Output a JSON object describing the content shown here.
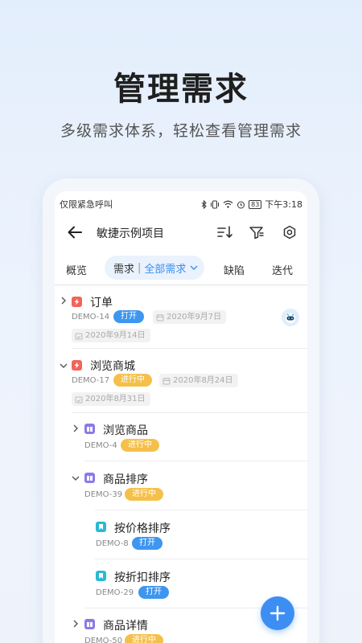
{
  "promo": {
    "title": "管理需求",
    "subtitle": "多级需求体系，轻松查看管理需求"
  },
  "status_bar": {
    "left_text": "仅限紧急呼叫",
    "battery": "83",
    "time": "下午3:18"
  },
  "header": {
    "title": "敏捷示例项目"
  },
  "tabs": {
    "overview": "概览",
    "requirements": "需求",
    "requirements_separator": "|",
    "requirements_filter": "全部需求",
    "defects": "缺陷",
    "iterations": "迭代"
  },
  "items": [
    {
      "title": "订单",
      "id": "DEMO-14",
      "status": "打开",
      "start": "2020年9月7日",
      "end": "2020年9月14日",
      "type": "epic",
      "expanded": false
    },
    {
      "title": "浏览商城",
      "id": "DEMO-17",
      "status": "进行中",
      "start": "2020年8月24日",
      "end": "2020年8月31日",
      "type": "epic",
      "expanded": true
    },
    {
      "title": "浏览商品",
      "id": "DEMO-4",
      "status": "进行中",
      "type": "feature",
      "expanded": false
    },
    {
      "title": "商品排序",
      "id": "DEMO-39",
      "status": "进行中",
      "type": "feature",
      "expanded": true
    },
    {
      "title": "按价格排序",
      "id": "DEMO-8",
      "status": "打开",
      "type": "story"
    },
    {
      "title": "按折扣排序",
      "id": "DEMO-29",
      "status": "打开",
      "type": "story"
    },
    {
      "title": "商品详情",
      "id": "DEMO-50",
      "status": "进行中",
      "type": "feature",
      "expanded": false
    }
  ],
  "colors": {
    "accent": "#3d8ef3",
    "open": "#3d96ef",
    "in_progress": "#f5c04a",
    "epic": "#f2645a",
    "feature": "#8b7be8",
    "story": "#2bb8d8"
  }
}
